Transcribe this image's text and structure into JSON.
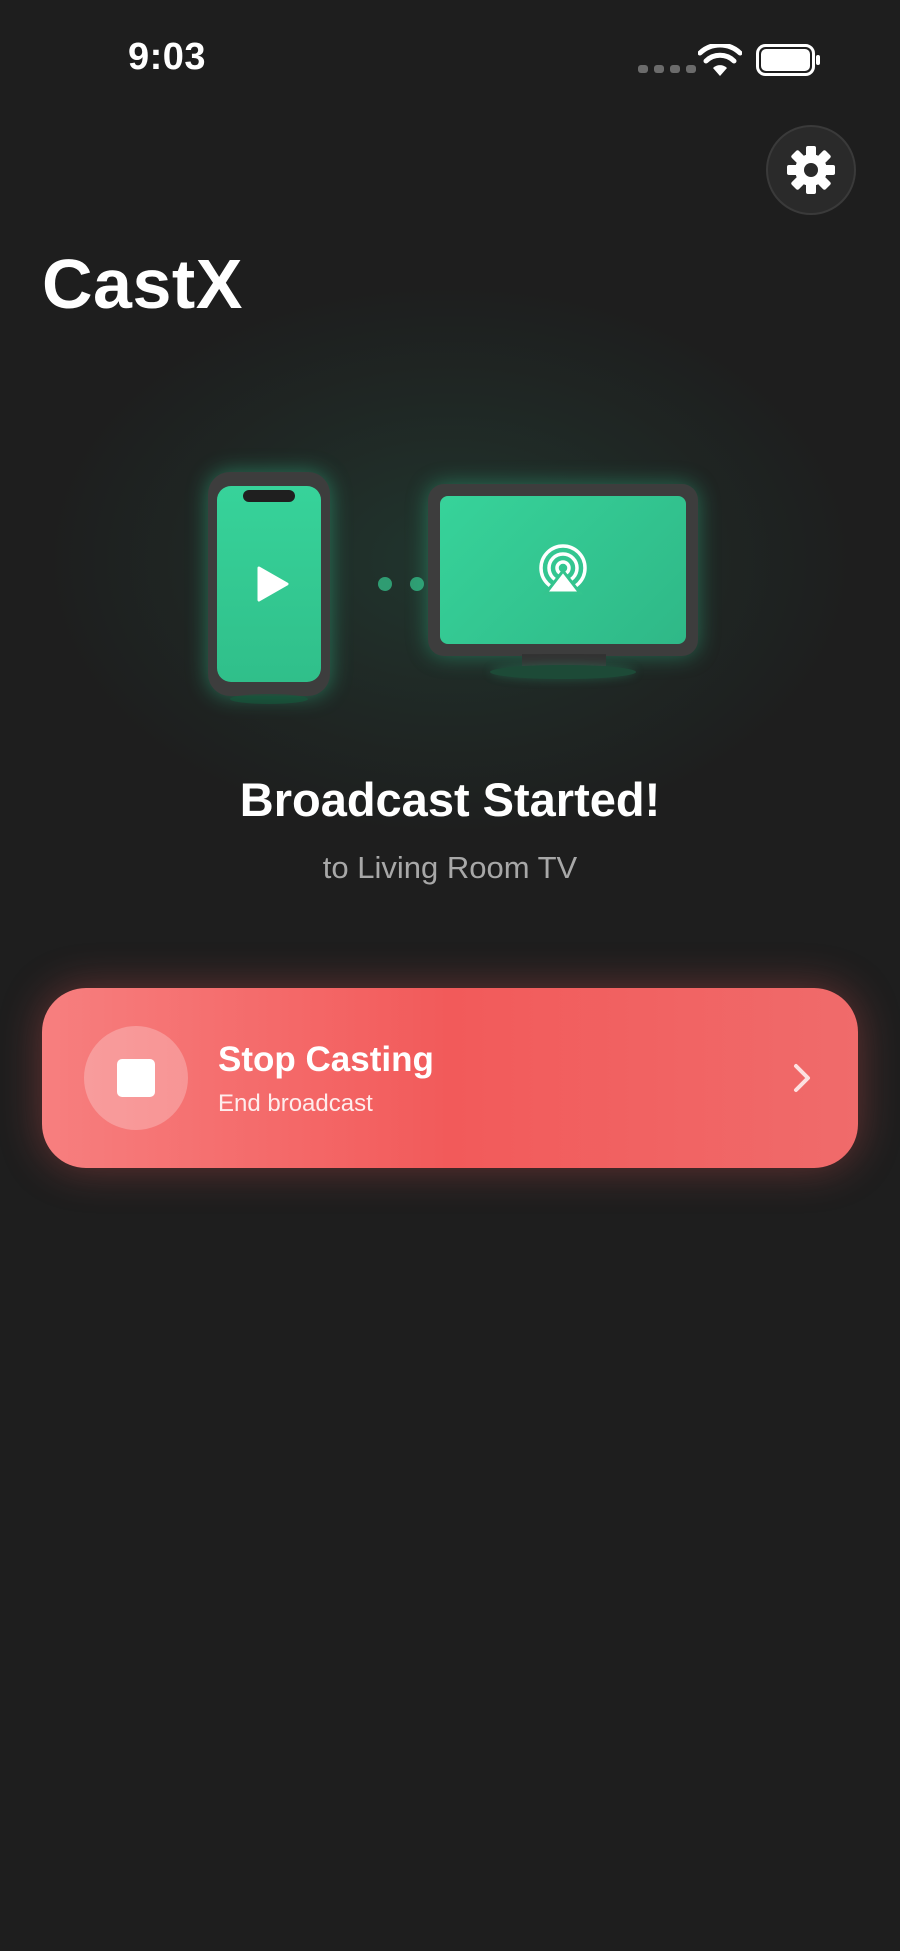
{
  "status_bar": {
    "time": "9:03",
    "icons": [
      "cellular-dots-icon",
      "wifi-icon",
      "battery-icon"
    ]
  },
  "header": {
    "title": "CastX",
    "settings_icon": "gear-icon"
  },
  "illustration": {
    "source_device_icon": "phone-play-icon",
    "target_device_icon": "tv-airplay-icon",
    "accent_color": "#34d399"
  },
  "status": {
    "title": "Broadcast Started!",
    "subtitle": "to Living Room TV"
  },
  "action_card": {
    "title": "Stop Casting",
    "subtitle": "End broadcast",
    "icon": "stop-icon",
    "trailing_icon": "chevron-right-icon",
    "color": "#f25a5a"
  },
  "colors": {
    "background": "#1e1e1e",
    "accent_green": "#34d399",
    "danger_red": "#f25a5a"
  }
}
